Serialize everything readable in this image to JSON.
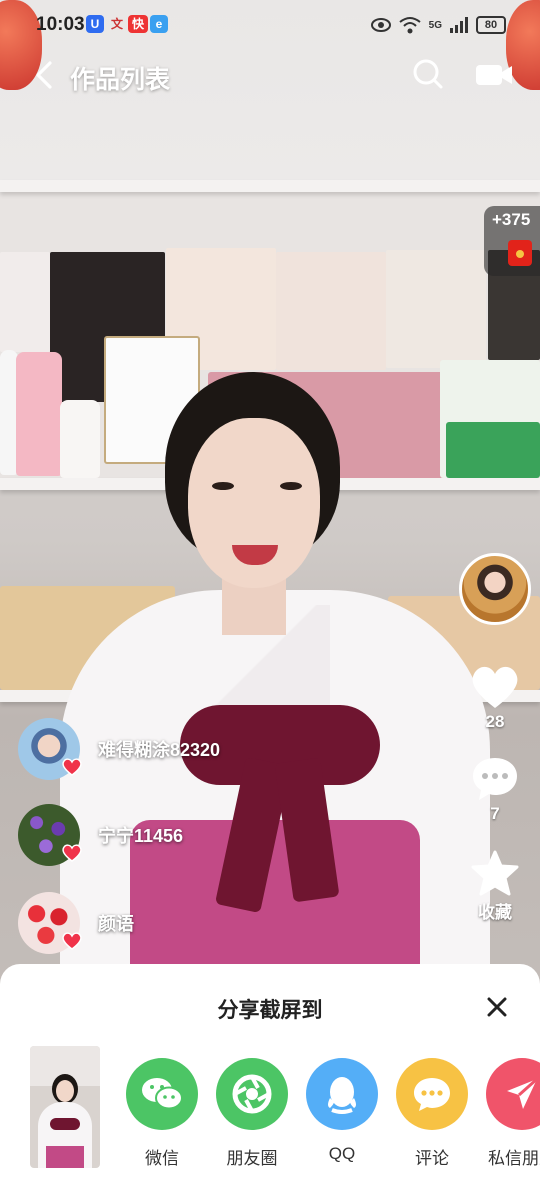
{
  "status_bar": {
    "time": "10:03",
    "app_badges": [
      "u-icon",
      "wen-icon",
      "kuai-icon",
      "browser-icon"
    ],
    "network": "5G",
    "battery": "80"
  },
  "nav": {
    "title": "作品列表",
    "back_icon": "chevron-left-icon",
    "search_icon": "search-icon",
    "camera_icon": "video-camera-icon"
  },
  "right_rail": {
    "coin_bonus": "+375",
    "likes": "28",
    "comments": "7",
    "favorite_label": "收藏"
  },
  "fans": [
    {
      "name": "难得糊涂82320",
      "avatar": "child-avatar"
    },
    {
      "name": "宁宁11456",
      "avatar": "purple-flowers-avatar"
    },
    {
      "name": "颜语",
      "avatar": "strawberries-avatar"
    }
  ],
  "share_sheet": {
    "title": "分享截屏到",
    "targets": [
      {
        "label": "微信",
        "color": "#4cc565",
        "icon": "wechat-icon"
      },
      {
        "label": "朋友圈",
        "color": "#4cc565",
        "icon": "moments-icon"
      },
      {
        "label": "QQ",
        "color": "#54aef7",
        "icon": "qq-icon"
      },
      {
        "label": "评论",
        "color": "#f7c244",
        "icon": "comment-icon"
      },
      {
        "label": "私信朋友",
        "color": "#f0546a",
        "icon": "send-icon"
      }
    ]
  }
}
